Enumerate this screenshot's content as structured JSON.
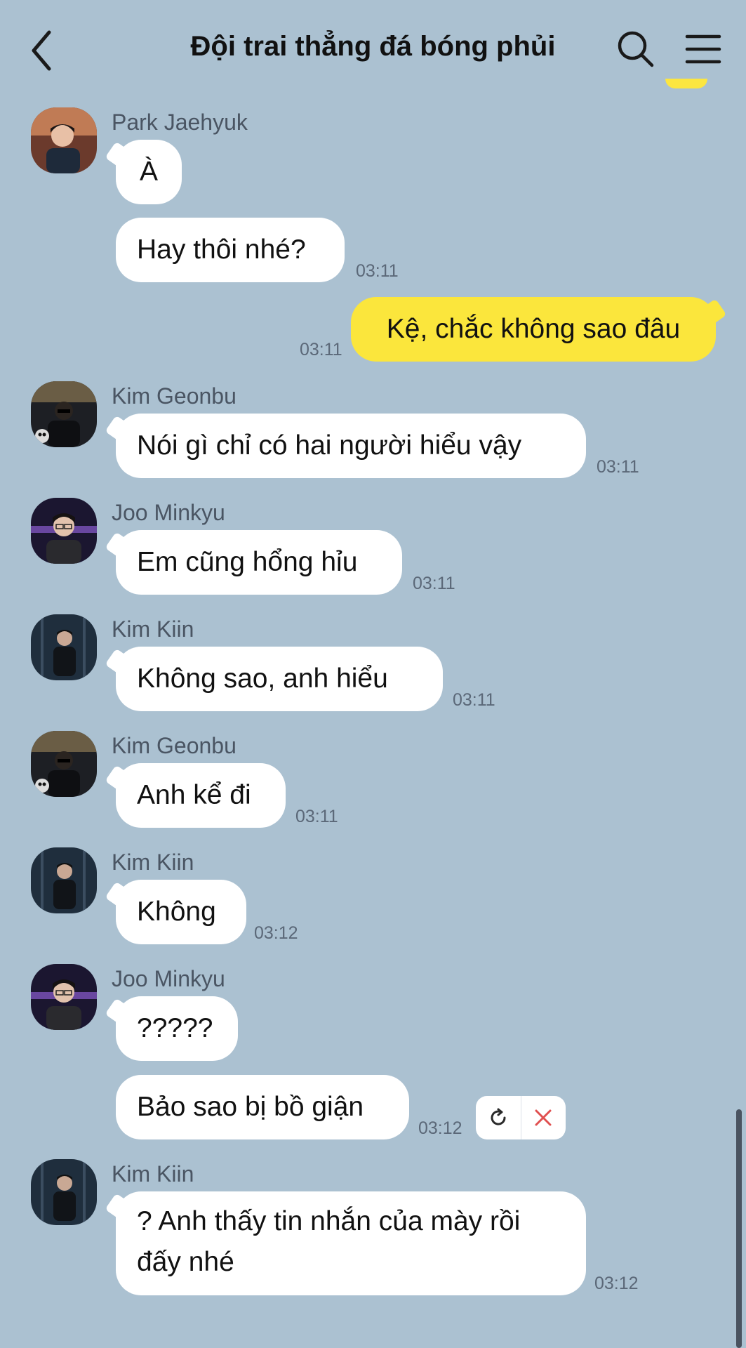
{
  "header": {
    "title": "Đội trai thẳng đá bóng phủi"
  },
  "icons": {
    "back": "chevron-left-icon",
    "search": "search-icon",
    "menu": "hamburger-menu-icon"
  },
  "colors": {
    "background": "#abc1d1",
    "my_bubble": "#fbe63c",
    "other_bubble": "#ffffff",
    "cancel": "#e05050"
  },
  "messages": [
    {
      "sender": "Park Jaehyuk",
      "text": "À",
      "time": ""
    },
    {
      "sender": "",
      "text": "Hay thôi nhé?",
      "time": "03:11"
    },
    {
      "sender": "me",
      "text": "Kệ, chắc không sao đâu",
      "time": "03:11"
    },
    {
      "sender": "Kim Geonbu",
      "text": "Nói gì chỉ có hai người hiểu vậy",
      "time": "03:11"
    },
    {
      "sender": "Joo Minkyu",
      "text": "Em cũng hổng hỉu",
      "time": "03:11"
    },
    {
      "sender": "Kim Kiin",
      "text": "Không sao, anh hiểu",
      "time": "03:11"
    },
    {
      "sender": "Kim Geonbu",
      "text": "Anh kể đi",
      "time": "03:11"
    },
    {
      "sender": "Kim Kiin",
      "text": "Không",
      "time": "03:12"
    },
    {
      "sender": "Joo Minkyu",
      "text": "?????",
      "time": ""
    },
    {
      "sender": "",
      "text": "Bảo sao bị bồ giận",
      "time": "03:12"
    },
    {
      "sender": "Kim Kiin",
      "text": "? Anh thấy tin nhắn của mày rồi đấy nhé",
      "time": "03:12"
    }
  ],
  "failed_message_actions": {
    "retry_icon": "refresh-icon",
    "cancel_icon": "close-icon"
  }
}
